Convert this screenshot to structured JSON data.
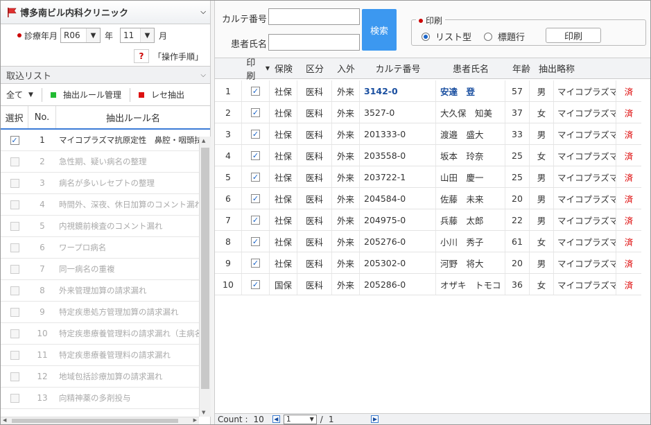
{
  "clinic": {
    "name": "博多南ビル内科クリニック"
  },
  "period": {
    "label": "診療年月",
    "era": "R06",
    "year_suffix": "年",
    "month": "11",
    "month_suffix": "月"
  },
  "help": {
    "icon_text": "?",
    "link": "「操作手順」"
  },
  "import_list": {
    "title": "取込リスト"
  },
  "toolbar": {
    "all_label": "全て",
    "rules_label": "抽出ルール管理",
    "extract_label": "レセ抽出",
    "colors": {
      "rules": "#22bb33",
      "extract": "#dd1111"
    }
  },
  "rules_table": {
    "headers": [
      "選択",
      "No.",
      "抽出ルール名"
    ],
    "rows": [
      {
        "no": "1",
        "name": "マイコプラズマ抗原定性　鼻腔・咽頭拭",
        "checked": true,
        "enabled": true
      },
      {
        "no": "2",
        "name": "急性期、疑い病名の整理",
        "checked": false,
        "enabled": false
      },
      {
        "no": "3",
        "name": "病名が多いレセプトの整理",
        "checked": false,
        "enabled": false
      },
      {
        "no": "4",
        "name": "時間外、深夜、休日加算のコメント漏れ",
        "checked": false,
        "enabled": false
      },
      {
        "no": "5",
        "name": "内視鏡前検査のコメント漏れ",
        "checked": false,
        "enabled": false
      },
      {
        "no": "6",
        "name": "ワープロ病名",
        "checked": false,
        "enabled": false
      },
      {
        "no": "7",
        "name": "同一病名の重複",
        "checked": false,
        "enabled": false
      },
      {
        "no": "8",
        "name": "外来管理加算の請求漏れ",
        "checked": false,
        "enabled": false
      },
      {
        "no": "9",
        "name": "特定疾患処方管理加算の請求漏れ",
        "checked": false,
        "enabled": false
      },
      {
        "no": "10",
        "name": "特定疾患療養管理料の請求漏れ（主病名",
        "checked": false,
        "enabled": false
      },
      {
        "no": "11",
        "name": "特定疾患療養管理料の請求漏れ",
        "checked": false,
        "enabled": false
      },
      {
        "no": "12",
        "name": "地域包括診療加算の請求漏れ",
        "checked": false,
        "enabled": false
      },
      {
        "no": "13",
        "name": "向精神薬の多剤投与",
        "checked": false,
        "enabled": false
      }
    ]
  },
  "search": {
    "karte_label": "カルテ番号",
    "karte_value": "",
    "name_label": "患者氏名",
    "name_value": "",
    "button": "検索"
  },
  "print": {
    "legend": "印刷",
    "option_list": "リスト型",
    "option_title": "標題行",
    "selected": "list",
    "button": "印刷"
  },
  "grid": {
    "headers": [
      "印刷",
      "保険",
      "区分",
      "入外",
      "カルテ番号",
      "患者氏名",
      "年齢",
      "抽出略称"
    ],
    "rows": [
      {
        "idx": "1",
        "ins": "社保",
        "cat": "医科",
        "io": "外来",
        "karte": "3142-0",
        "name": "安達　登",
        "age": "57",
        "sex": "男",
        "abbr": "マイコプラズマ",
        "status": "済",
        "highlight": true
      },
      {
        "idx": "2",
        "ins": "社保",
        "cat": "医科",
        "io": "外来",
        "karte": "3527-0",
        "name": "大久保　知美",
        "age": "37",
        "sex": "女",
        "abbr": "マイコプラズマ",
        "status": "済",
        "highlight": false
      },
      {
        "idx": "3",
        "ins": "社保",
        "cat": "医科",
        "io": "外来",
        "karte": "201333-0",
        "name": "渡邉　盛大",
        "age": "33",
        "sex": "男",
        "abbr": "マイコプラズマ",
        "status": "済",
        "highlight": false
      },
      {
        "idx": "4",
        "ins": "社保",
        "cat": "医科",
        "io": "外来",
        "karte": "203558-0",
        "name": "坂本　玲奈",
        "age": "25",
        "sex": "女",
        "abbr": "マイコプラズマ",
        "status": "済",
        "highlight": false
      },
      {
        "idx": "5",
        "ins": "社保",
        "cat": "医科",
        "io": "外来",
        "karte": "203722-1",
        "name": "山田　慶一",
        "age": "25",
        "sex": "男",
        "abbr": "マイコプラズマ",
        "status": "済",
        "highlight": false
      },
      {
        "idx": "6",
        "ins": "社保",
        "cat": "医科",
        "io": "外来",
        "karte": "204584-0",
        "name": "佐藤　未来",
        "age": "20",
        "sex": "男",
        "abbr": "マイコプラズマ",
        "status": "済",
        "highlight": false
      },
      {
        "idx": "7",
        "ins": "社保",
        "cat": "医科",
        "io": "外来",
        "karte": "204975-0",
        "name": "兵藤　太郎",
        "age": "22",
        "sex": "男",
        "abbr": "マイコプラズマ",
        "status": "済",
        "highlight": false
      },
      {
        "idx": "8",
        "ins": "社保",
        "cat": "医科",
        "io": "外来",
        "karte": "205276-0",
        "name": "小川　秀子",
        "age": "61",
        "sex": "女",
        "abbr": "マイコプラズマ",
        "status": "済",
        "highlight": false
      },
      {
        "idx": "9",
        "ins": "社保",
        "cat": "医科",
        "io": "外来",
        "karte": "205302-0",
        "name": "河野　将大",
        "age": "20",
        "sex": "男",
        "abbr": "マイコプラズマ",
        "status": "済",
        "highlight": false
      },
      {
        "idx": "10",
        "ins": "国保",
        "cat": "医科",
        "io": "外来",
        "karte": "205286-0",
        "name": "オザキ　トモコ",
        "age": "36",
        "sex": "女",
        "abbr": "マイコプラズマ",
        "status": "済",
        "highlight": false
      }
    ]
  },
  "footer": {
    "count_label": "Count :",
    "count": "10",
    "page": "1",
    "sep": "/",
    "total_pages": "1"
  }
}
